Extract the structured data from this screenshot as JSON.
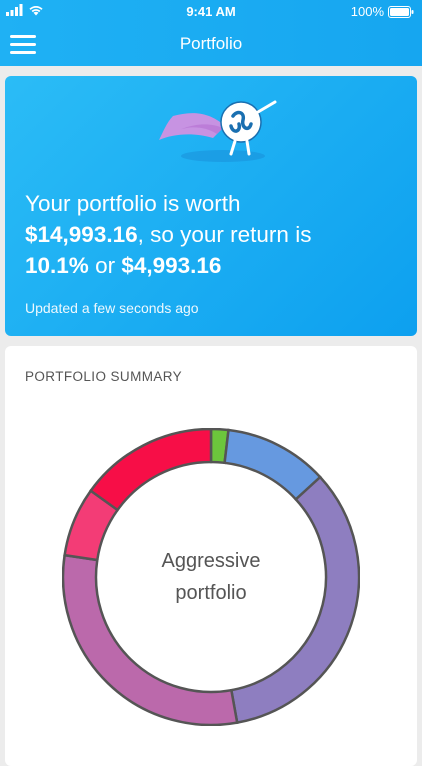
{
  "status_bar": {
    "time": "9:41 AM",
    "battery": "100%"
  },
  "nav": {
    "title": "Portfolio"
  },
  "hero": {
    "line1": "Your portfolio is worth",
    "value": "$14,993.16",
    "line2": ", so your return is",
    "return_pct": "10.1%",
    "or_text": " or ",
    "return_amount": "$4,993.16",
    "updated": "Updated a few seconds ago"
  },
  "summary": {
    "title": "PORTFOLIO SUMMARY",
    "center_line1": "Aggressive",
    "center_line2": "portfolio"
  },
  "colors": {
    "header": "#1aa9f2",
    "green": "#6cc63c",
    "blue": "#6699e0",
    "purple": "#8e7ec0",
    "mauve": "#bb69ab",
    "pink": "#f33c76",
    "red": "#f70e47"
  },
  "chart_data": {
    "type": "pie",
    "values": [
      2,
      12,
      36,
      32,
      8,
      16
    ],
    "colors": [
      "#6cc63c",
      "#6699e0",
      "#8e7ec0",
      "#bb69ab",
      "#f33c76",
      "#f70e47"
    ]
  }
}
